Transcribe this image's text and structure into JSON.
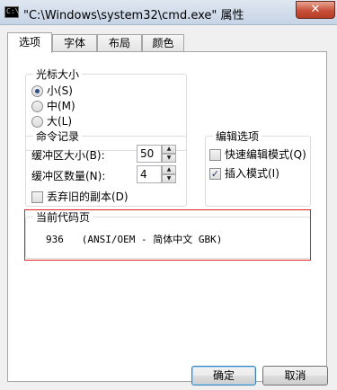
{
  "window": {
    "title": "\"C:\\Windows\\system32\\cmd.exe\" 属性",
    "icon_text": "C:\\",
    "close_symbol": "✕"
  },
  "tabs": [
    {
      "label": "选项",
      "active": true
    },
    {
      "label": "字体",
      "active": false
    },
    {
      "label": "布局",
      "active": false
    },
    {
      "label": "颜色",
      "active": false
    }
  ],
  "cursor_size": {
    "title": "光标大小",
    "options": [
      {
        "label": "小(S)",
        "selected": true
      },
      {
        "label": "中(M)",
        "selected": false
      },
      {
        "label": "大(L)",
        "selected": false
      }
    ]
  },
  "command_history": {
    "title": "命令记录",
    "buffer_size_label": "缓冲区大小(B):",
    "buffer_size_value": "50",
    "buffer_count_label": "缓冲区数量(N):",
    "buffer_count_value": "4",
    "discard_label": "丢弃旧的副本(D)",
    "discard_checked": false
  },
  "edit_options": {
    "title": "编辑选项",
    "quick_edit_label": "快速编辑模式(Q)",
    "quick_edit_checked": false,
    "insert_mode_label": "插入模式(I)",
    "insert_mode_checked": true
  },
  "code_page": {
    "title": "当前代码页",
    "value": "936   (ANSI/OEM - 简体中文 GBK)"
  },
  "buttons": {
    "ok": "确定",
    "cancel": "取消"
  },
  "spin": {
    "up": "▲",
    "down": "▼"
  },
  "check_mark": "✓",
  "colors": {
    "highlight_border": "#e02020",
    "close_button": "#c7503a"
  }
}
